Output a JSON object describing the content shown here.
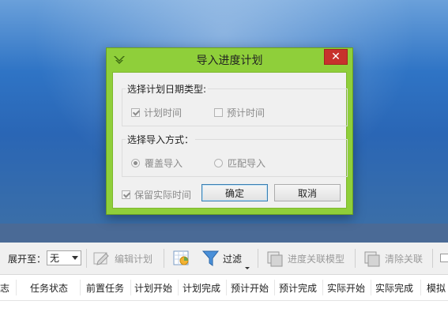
{
  "dialog": {
    "title": "导入进度计划",
    "close_glyph": "✕",
    "date_group": {
      "title": "选择计划日期类型:",
      "options": [
        {
          "label": "计划时间",
          "checked": true
        },
        {
          "label": "预计时间",
          "checked": false
        }
      ]
    },
    "import_group": {
      "title": "选择导入方式：",
      "options": [
        {
          "label": "覆盖导入",
          "selected": true
        },
        {
          "label": "匹配导入",
          "selected": false
        }
      ]
    },
    "keep_actual": {
      "label": "保留实际时间",
      "checked": true
    },
    "ok_label": "确定",
    "cancel_label": "取消"
  },
  "toolbar": {
    "expand_label": "展开至：",
    "expand_value": "无",
    "edit_plan": "编辑计划",
    "filter": "过滤",
    "progress_link_model": "进度关联模型",
    "clear_link": "清除关联"
  },
  "grid": {
    "columns": [
      "志",
      "任务状态",
      "前置任务",
      "计划开始",
      "计划完成",
      "预计开始",
      "预计完成",
      "实际开始",
      "实际完成",
      "模拟"
    ]
  },
  "colors": {
    "dialog_frame": "#8fcf3a",
    "close_button": "#c7322c",
    "app_blue": "#2f74c5"
  }
}
